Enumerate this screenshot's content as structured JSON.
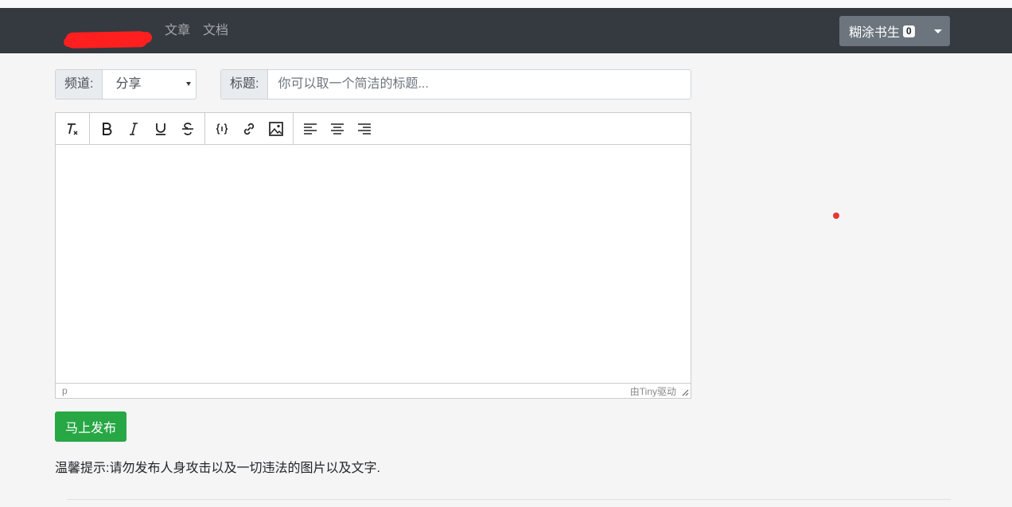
{
  "nav": {
    "links": [
      "文章",
      "文档"
    ],
    "user": {
      "name": "糊涂书生",
      "badge": "0"
    }
  },
  "form": {
    "channel_label": "频道:",
    "channel_value": "分享",
    "title_label": "标题:",
    "title_placeholder": "你可以取一个简洁的标题..."
  },
  "editor": {
    "toolbar_icons": [
      [
        "remove-format-icon"
      ],
      [
        "bold-icon",
        "italic-icon",
        "underline-icon",
        "strikethrough-icon"
      ],
      [
        "code-icon",
        "link-icon",
        "image-icon"
      ],
      [
        "align-left-icon",
        "align-center-icon",
        "align-right-icon"
      ]
    ],
    "status_path": "p",
    "powered_by": "由Tiny驱动"
  },
  "actions": {
    "publish_label": "马上发布"
  },
  "tip": "温馨提示:请勿发布人身攻击以及一切违法的图片以及文字.",
  "colors": {
    "navbar": "#343a40",
    "publish": "#28a745",
    "user_button": "#6c757d"
  }
}
